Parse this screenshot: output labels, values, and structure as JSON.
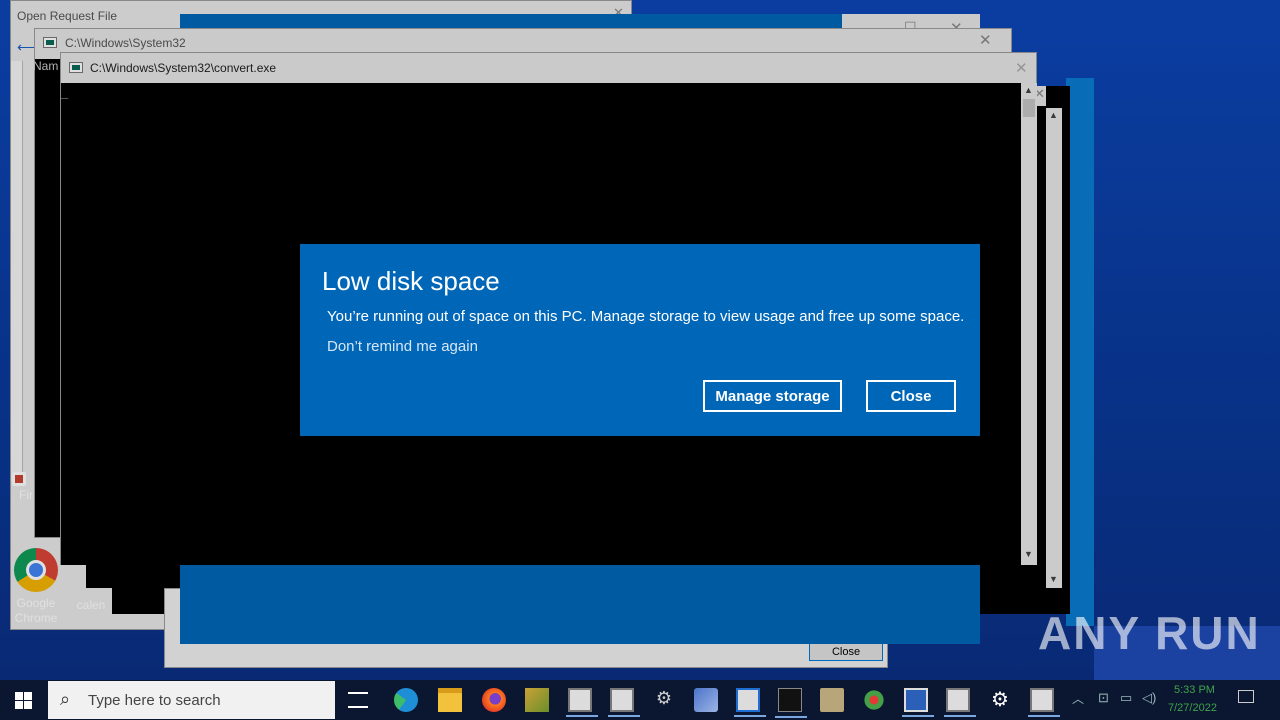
{
  "background_windows": {
    "open_request_title": "Open Request File",
    "cmd_title_1": "C:\\Windows\\System32",
    "name_col": "Nam",
    "close_label": "Close"
  },
  "desktop_icons": [
    {
      "label": "Fir"
    },
    {
      "label": "Google Chrome"
    },
    {
      "label": "calen"
    }
  ],
  "main_window": {
    "title": "C:\\Windows\\System32\\convert.exe",
    "cursor": "_"
  },
  "dialog": {
    "title": "Low disk space",
    "message": "You’re running out of space on this PC. Manage storage to view usage and free up some space.",
    "link": "Don’t remind me again",
    "primary_button": "Manage storage",
    "secondary_button": "Close"
  },
  "taskbar": {
    "search_placeholder": "Type here to search",
    "time": "5:33 PM",
    "date": "7/27/2022"
  },
  "watermark": "ANY RUN",
  "colors": {
    "dialog_bg": "#0067b8",
    "desktop": "#0d46b8",
    "taskbar": "#0b1630"
  }
}
